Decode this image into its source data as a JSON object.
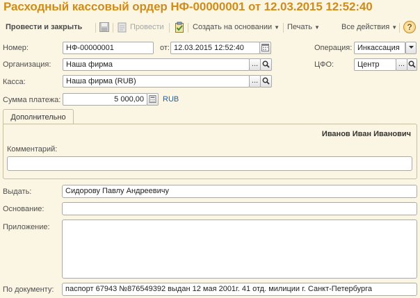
{
  "window": {
    "title": "Расходный кассовый ордер НФ-00000001 от 12.03.2015 12:52:40"
  },
  "toolbar": {
    "post_close": "Провести и закрыть",
    "post": "Провести",
    "create_based": "Создать на основании",
    "print": "Печать",
    "all_actions": "Все действия",
    "help": "?"
  },
  "form": {
    "number_label": "Номер:",
    "number_value": "НФ-00000001",
    "date_label": "от:",
    "date_value": "12.03.2015 12:52:40",
    "operation_label": "Операция:",
    "operation_value": "Инкассация",
    "org_label": "Организация:",
    "org_value": "Наша фирма",
    "cfo_label": "ЦФО:",
    "cfo_value": "Центр",
    "cash_label": "Касса:",
    "cash_value": "Наша фирма (RUB)",
    "sum_label": "Сумма платежа:",
    "sum_value": "5 000,00",
    "currency": "RUB",
    "select_btn": "...",
    "tab_additional": "Дополнительно",
    "responsible": "Иванов Иван Иванович",
    "comment_label": "Комментарий:",
    "issue_label": "Выдать:",
    "issue_value": "Сидорову Павлу Андреевичу",
    "basis_label": "Основание:",
    "attachment_label": "Приложение:",
    "doc_label": "По документу:",
    "doc_value": "паспорт 67943 №876549392 выдан 12 мая 2001г. 41 отд. милиции г. Санкт-Петербурга"
  }
}
